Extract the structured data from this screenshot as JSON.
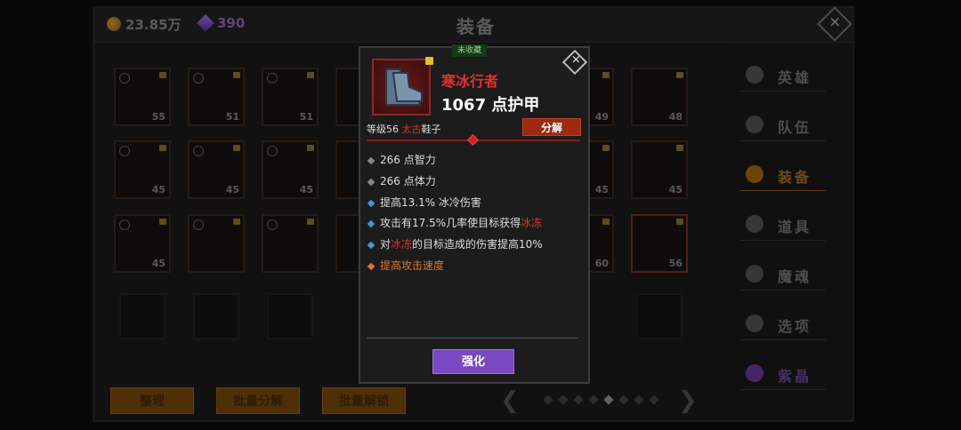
{
  "header": {
    "coins": "23.85万",
    "gems": "390",
    "title": "装备"
  },
  "grid": {
    "rows": [
      [
        "55",
        "51",
        "51",
        "",
        "",
        "",
        "49",
        "48"
      ],
      [
        "45",
        "45",
        "45",
        "",
        "",
        "45",
        "",
        "45"
      ],
      [
        "45",
        "",
        "",
        "",
        "",
        "",
        "60",
        "56"
      ]
    ]
  },
  "sidebar": {
    "items": [
      {
        "label": "英雄"
      },
      {
        "label": "队伍"
      },
      {
        "label": "装备"
      },
      {
        "label": "道具"
      },
      {
        "label": "魔魂"
      },
      {
        "label": "选项"
      },
      {
        "label": "紫晶"
      }
    ]
  },
  "footer": {
    "sort_label": "整理",
    "batch_disassemble_label": "批量分解",
    "batch_unlock_label": "批量解锁",
    "pager_prev": "❮",
    "pager_next": "❯"
  },
  "tooltip": {
    "badge": "未收藏",
    "item_name": "寒冰行者",
    "armor": "1067 点护甲",
    "level_prefix": "等级56 ",
    "quality": "太古",
    "item_type": "鞋子",
    "disassemble_label": "分解",
    "stats": [
      {
        "text": "266 点智力"
      },
      {
        "text": "266 点体力"
      },
      {
        "text": "提高13.1% 冰冷伤害"
      },
      {
        "pre": "攻击有17.5%几率使目标获得",
        "hl": "冰冻"
      },
      {
        "pre": "对",
        "hl": "冰冻",
        "post": "的目标造成的伤害提高10%"
      },
      {
        "text": "提高攻击速度"
      }
    ],
    "enhance_label": "强化"
  }
}
